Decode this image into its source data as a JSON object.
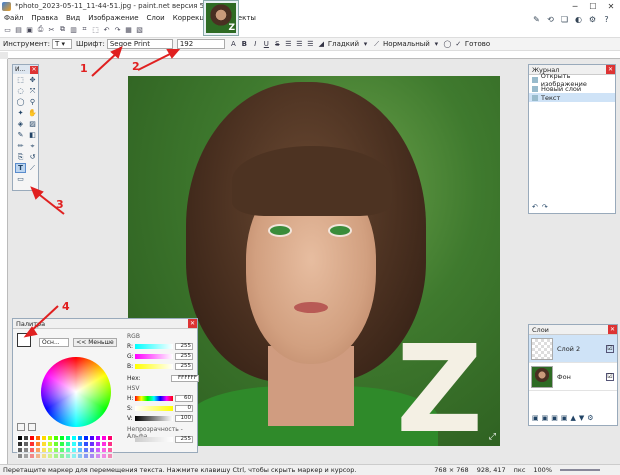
{
  "window": {
    "title": "*photo_2023-05-11_11-44-51.jpg - paint.net версия 5.0.3",
    "minimize": "─",
    "maximize": "☐",
    "close": "✕"
  },
  "menu": [
    "Файл",
    "Правка",
    "Вид",
    "Изображение",
    "Слои",
    "Коррекция",
    "Эффекты"
  ],
  "options": {
    "tool_label": "Инструмент:",
    "font_label": "Шрифт:",
    "font_value": "Segoe Print",
    "size_value": "192",
    "rendering_value": "Гладкий",
    "blend_mode": "Нормальный",
    "finish_label": "Готово"
  },
  "tools_window": {
    "title": "И..."
  },
  "history": {
    "title": "Журнал",
    "items": [
      "Открыть изображение",
      "Новый слой",
      "Текст"
    ]
  },
  "layers": {
    "title": "Слои",
    "items": [
      {
        "name": "Слой 2",
        "checked": "☑"
      },
      {
        "name": "Фон",
        "checked": "☑"
      }
    ]
  },
  "palette": {
    "title": "Палитра",
    "dropdown": "Осн...",
    "less_button": "<< Меньше",
    "rgb_label": "RGB",
    "r": "255",
    "g": "255",
    "b": "255",
    "hex_label": "Hex:",
    "hex": "FFFFFF",
    "hsv_label": "HSV",
    "h": "60",
    "s": "0",
    "v": "100",
    "alpha_label": "Непрозрачность - Альфа",
    "alpha": "255",
    "letters": {
      "r": "R:",
      "g": "G:",
      "b": "B:",
      "h": "H:",
      "s": "S:",
      "v": "V:"
    }
  },
  "canvas": {
    "text_layer_letter": "Z"
  },
  "thumbnail": {
    "letter": "Z"
  },
  "status": {
    "message": "Перетащите маркер для перемещения текста. Нажмите клавишу Ctrl, чтобы скрыть маркер и курсор.",
    "image_size": "768 × 768",
    "cursor_pos": "928, 417",
    "units": "пкс",
    "zoom": "100%"
  },
  "annotations": [
    "1",
    "2",
    "3",
    "4"
  ],
  "colors": {
    "accent": "#5a8ccc",
    "arrow": "#e02020",
    "panel_close": "#d33333"
  }
}
